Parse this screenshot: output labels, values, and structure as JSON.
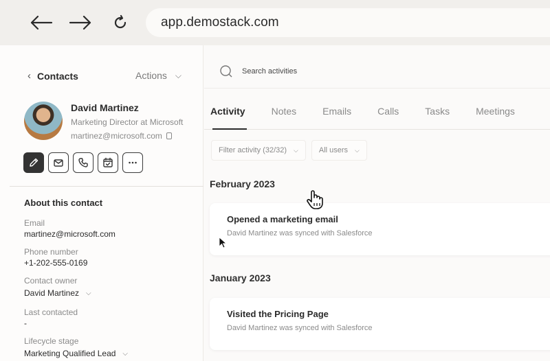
{
  "browser": {
    "url": "app.demostack.com",
    "back_icon": "arrow-left-icon",
    "forward_icon": "arrow-right-icon",
    "reload_icon": "reload-icon"
  },
  "contact": {
    "back_label": "Contacts",
    "actions_label": "Actions",
    "name": "David Martinez",
    "role": "Marketing Director at Microsoft",
    "email": "martinez@microsoft.com",
    "action_icons": [
      "edit-icon",
      "email-icon",
      "phone-icon",
      "calendar-icon",
      "more-icon"
    ]
  },
  "about": {
    "title": "About this contact",
    "fields": [
      {
        "label": "Email",
        "value": "martinez@microsoft.com"
      },
      {
        "label": "Phone number",
        "value": "+1-202-555-0169"
      },
      {
        "label": "Contact owner",
        "value": "David Martinez"
      },
      {
        "label": "Last contacted",
        "value": "-"
      },
      {
        "label": "Lifecycle stage",
        "value": "Marketing Qualified Lead"
      }
    ]
  },
  "activity": {
    "search_placeholder": "Search activities",
    "tabs": [
      "Activity",
      "Notes",
      "Emails",
      "Calls",
      "Tasks",
      "Meetings"
    ],
    "active_tab": "Activity",
    "filter_label": "Filter activity (32/32)",
    "users_label": "All users",
    "groups": [
      {
        "month": "February 2023",
        "items": [
          {
            "title": "Opened a marketing email",
            "subtitle": "David Martinez was synced with Salesforce"
          }
        ]
      },
      {
        "month": "January 2023",
        "items": [
          {
            "title": "Visited the Pricing Page",
            "subtitle": "David Martinez was synced with Salesforce"
          }
        ]
      }
    ]
  },
  "colors": {
    "background": "#fbfaf9",
    "accent": "#2a2a2a",
    "muted": "#8a8a8a"
  }
}
